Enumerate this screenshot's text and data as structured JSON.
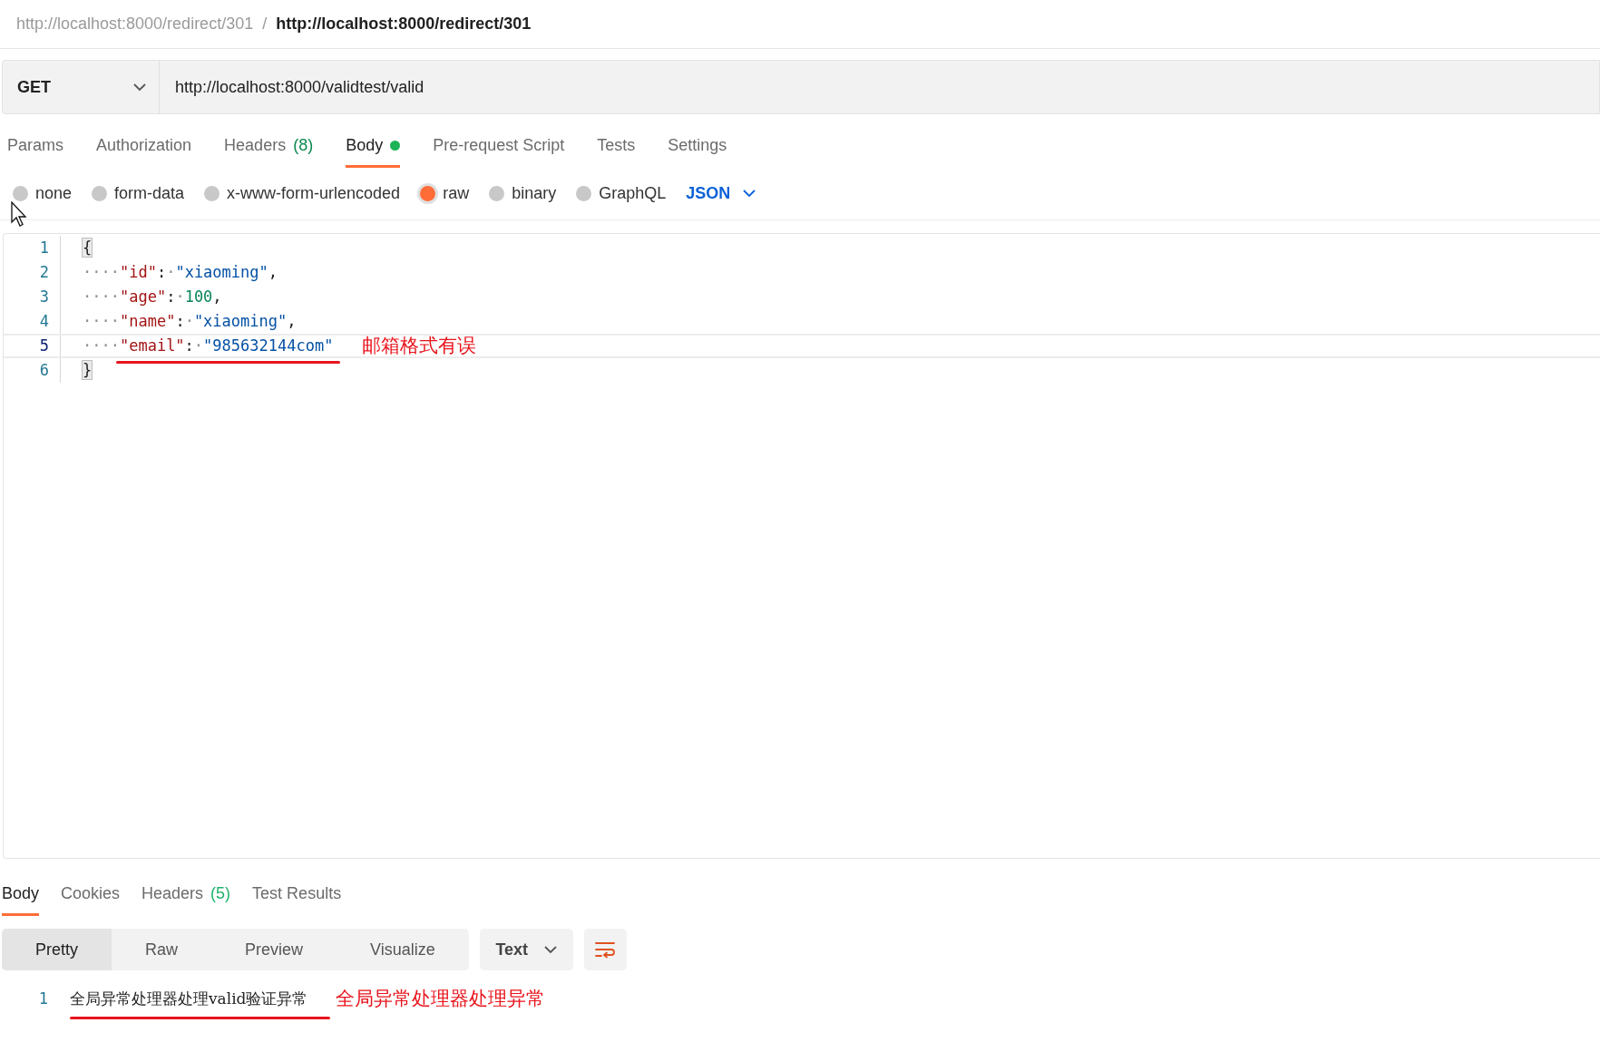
{
  "breadcrumb": {
    "items": [
      {
        "text": "http://localhost:8000/redirect/301",
        "current": false
      },
      {
        "text": "http://localhost:8000/redirect/301",
        "current": true
      }
    ],
    "separator": "/"
  },
  "request": {
    "method": "GET",
    "url": "http://localhost:8000/validtest/valid"
  },
  "request_tabs": [
    {
      "label": "Params",
      "selected": false
    },
    {
      "label": "Authorization",
      "selected": false
    },
    {
      "label": "Headers",
      "count": "(8)",
      "selected": false
    },
    {
      "label": "Body",
      "dot": true,
      "selected": true
    },
    {
      "label": "Pre-request Script",
      "selected": false
    },
    {
      "label": "Tests",
      "selected": false
    },
    {
      "label": "Settings",
      "selected": false
    }
  ],
  "body_types": [
    {
      "label": "none",
      "selected": false
    },
    {
      "label": "form-data",
      "selected": false
    },
    {
      "label": "x-www-form-urlencoded",
      "selected": false
    },
    {
      "label": "raw",
      "selected": true
    },
    {
      "label": "binary",
      "selected": false
    },
    {
      "label": "GraphQL",
      "selected": false
    }
  ],
  "body_format": "JSON",
  "editor": {
    "lines": [
      {
        "number": "1",
        "highlighted": false,
        "tokens": [
          {
            "kind": "bracket",
            "text": "{"
          }
        ]
      },
      {
        "number": "2",
        "highlighted": false,
        "tokens": [
          {
            "kind": "ws",
            "text": "····"
          },
          {
            "kind": "key",
            "text": "\"id\""
          },
          {
            "kind": "punct",
            "text": ":"
          },
          {
            "kind": "ws",
            "text": "·"
          },
          {
            "kind": "string",
            "text": "\"xiaoming\""
          },
          {
            "kind": "punct",
            "text": ","
          }
        ]
      },
      {
        "number": "3",
        "highlighted": false,
        "tokens": [
          {
            "kind": "ws",
            "text": "····"
          },
          {
            "kind": "key",
            "text": "\"age\""
          },
          {
            "kind": "punct",
            "text": ":"
          },
          {
            "kind": "ws",
            "text": "·"
          },
          {
            "kind": "number",
            "text": "100"
          },
          {
            "kind": "punct",
            "text": ","
          }
        ]
      },
      {
        "number": "4",
        "highlighted": false,
        "tokens": [
          {
            "kind": "ws",
            "text": "····"
          },
          {
            "kind": "key",
            "text": "\"name\""
          },
          {
            "kind": "punct",
            "text": ":"
          },
          {
            "kind": "ws",
            "text": "·"
          },
          {
            "kind": "string",
            "text": "\"xiaoming\""
          },
          {
            "kind": "punct",
            "text": ","
          }
        ]
      },
      {
        "number": "5",
        "highlighted": true,
        "underlined": true,
        "annotation": "邮箱格式有误",
        "tokens": [
          {
            "kind": "ws",
            "text": "····"
          },
          {
            "kind": "key",
            "text": "\"email\""
          },
          {
            "kind": "punct",
            "text": ":"
          },
          {
            "kind": "ws",
            "text": "·"
          },
          {
            "kind": "string",
            "text": "\"985632144com\""
          }
        ]
      },
      {
        "number": "6",
        "highlighted": false,
        "tokens": [
          {
            "kind": "bracket",
            "text": "}"
          }
        ]
      }
    ]
  },
  "response_tabs": [
    {
      "label": "Body",
      "selected": true
    },
    {
      "label": "Cookies",
      "selected": false
    },
    {
      "label": "Headers",
      "count": "(5)",
      "selected": false
    },
    {
      "label": "Test Results",
      "selected": false
    }
  ],
  "view_modes": [
    {
      "label": "Pretty",
      "selected": true
    },
    {
      "label": "Raw",
      "selected": false
    },
    {
      "label": "Preview",
      "selected": false
    },
    {
      "label": "Visualize",
      "selected": false
    }
  ],
  "response_format": "Text",
  "response_lines": [
    {
      "number": "1",
      "text": "全局异常处理器处理valid验证异常",
      "underlined": true,
      "annotation": "全局异常处理器处理异常"
    }
  ]
}
